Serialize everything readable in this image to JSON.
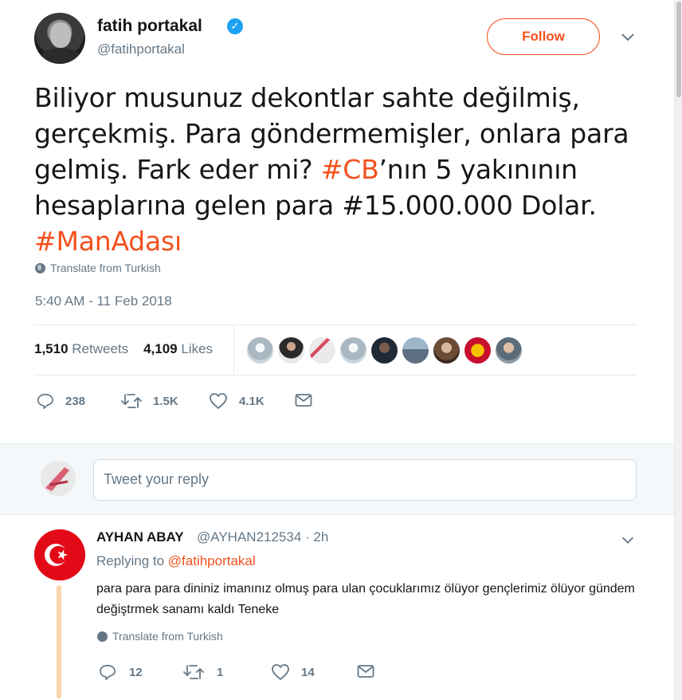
{
  "tweet": {
    "author_name": "fatih portakal",
    "author_handle": "@fatihportakal",
    "follow_label": "Follow",
    "text_parts": {
      "p1": "Biliyor musunuz dekontlar sahte değilmiş, gerçekmiş. Para göndermemişler, onlara para gelmiş. Fark eder mi? ",
      "hashtag1": "#CB",
      "p2": "’nın 5 yakınının hesaplarına gelen para #15.000.000 Dolar. ",
      "hashtag2": "#ManAdası"
    },
    "translate": "Translate from Turkish",
    "timestamp": "5:40 AM - 11 Feb 2018",
    "retweets_count": "1,510",
    "retweets_label": "Retweets",
    "likes_count": "4,109",
    "likes_label": "Likes",
    "actions": {
      "replies": "238",
      "retweets": "1.5K",
      "likes": "4.1K"
    }
  },
  "reply_box": {
    "placeholder": "Tweet your reply"
  },
  "reply": {
    "author_name": "AYHAN ABAY",
    "author_handle": "@AYHAN212534 · 2h",
    "replying_prefix": "Replying to",
    "replying_mention": "@fatihportakal",
    "text": "para para para dininiz imanınız olmuş para ulan çocuklarımız ölüyor gençlerimiz ölüyor gündem değiştrmek sanamı kaldı Teneke",
    "translate": "Translate from Turkish",
    "actions": {
      "replies": "12",
      "retweets": "1",
      "likes": "14"
    }
  },
  "colors": {
    "accent": "#f4511e",
    "verified": "#1da1f2",
    "muted": "#657786",
    "thread_line": "#f8d3ae"
  },
  "icons": [
    "verified-badge-icon",
    "chevron-down-icon",
    "globe-icon",
    "reply-icon",
    "retweet-icon",
    "heart-icon",
    "envelope-icon"
  ]
}
